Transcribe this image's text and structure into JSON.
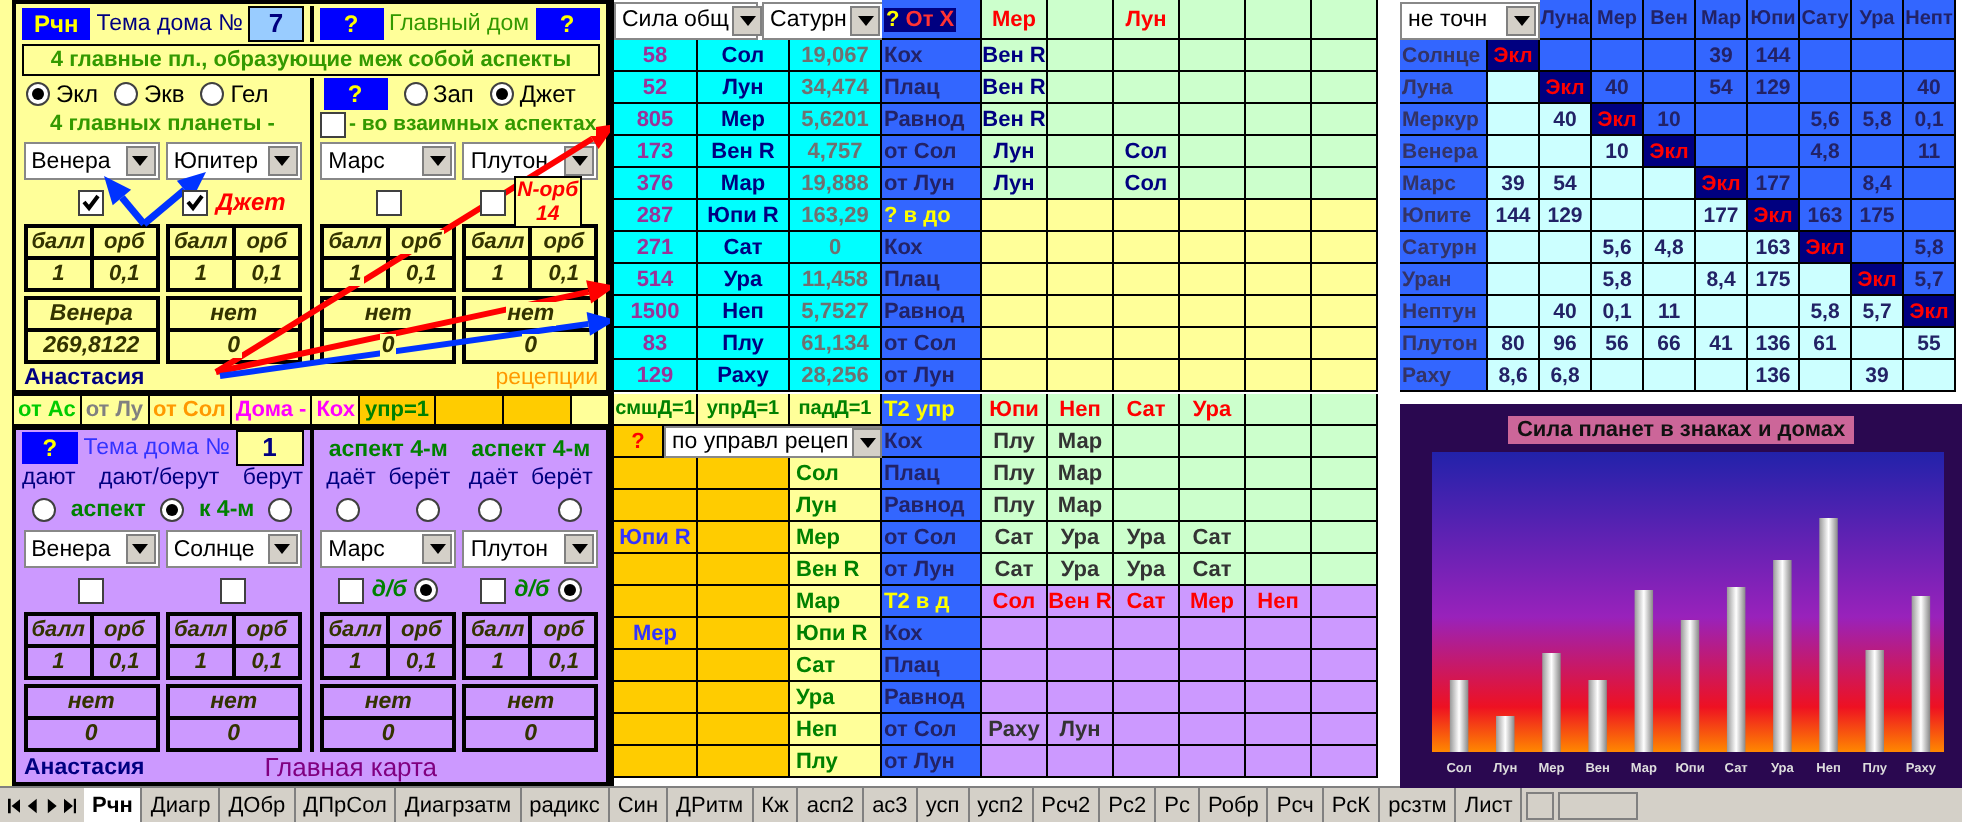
{
  "left_top": {
    "sheet_button": "Рчн",
    "theme_label": "Тема дома №",
    "theme_value": "7",
    "main_house_help": "?",
    "main_house_label": "Главный дом",
    "main_house_value": "?",
    "heading": "4 главные пл., образующие меж собой аспекты",
    "coord_options": [
      {
        "label": "Экл",
        "selected": true
      },
      {
        "label": "Экв",
        "selected": false
      },
      {
        "label": "Гел",
        "selected": false
      }
    ],
    "zodiac_help": "?",
    "zodiac_options": [
      {
        "label": "Зап",
        "selected": false
      },
      {
        "label": "Джет",
        "selected": true
      }
    ],
    "subheading": "4 главных планеты  -",
    "mutual": {
      "label": "- во взаимных аспектах",
      "checked": false
    },
    "blocks": [
      {
        "planet": "Венера",
        "checked": true,
        "score_label": "балл",
        "orb_label": "орб",
        "score": "1",
        "orb": "0,1",
        "result": "Венера",
        "value": "269,8122"
      },
      {
        "planet": "Юпитер",
        "checked": true,
        "note": "Джет",
        "score_label": "балл",
        "orb_label": "орб",
        "score": "1",
        "orb": "0,1",
        "result": "нет",
        "value": "0"
      },
      {
        "planet": "Марс",
        "checked": false,
        "score_label": "балл",
        "orb_label": "орб",
        "score": "1",
        "orb": "0,1",
        "result": "нет",
        "value": "0"
      },
      {
        "planet": "Плутон",
        "checked": false,
        "n_orb_label": "N-орб",
        "n_orb": "14",
        "score_label": "балл",
        "orb_label": "орб",
        "score": "1",
        "orb": "0,1",
        "result": "нет",
        "value": "0"
      }
    ],
    "name": "Анастасия",
    "receptions": "рецепции"
  },
  "strip": [
    {
      "text": "от Ас",
      "kind": "asc"
    },
    {
      "text": "от Лу",
      "kind": "moon"
    },
    {
      "text": "от Сол",
      "kind": "sun"
    },
    {
      "text": "Дома -",
      "kind": "house"
    },
    {
      "text": "Кох",
      "kind": "house"
    },
    {
      "text": "упр=1",
      "kind": "rule"
    }
  ],
  "left_bottom": {
    "help": "?",
    "theme_label": "Тема дома №",
    "theme_value": "1",
    "options": [
      {
        "label": "дают",
        "selected": false
      },
      {
        "label": "дают/берут",
        "selected": true
      },
      {
        "label": "берут",
        "selected": false
      }
    ],
    "caption_left": "аспект",
    "caption_right": "к 4-м",
    "blocks": [
      {
        "planet": "Венера",
        "checked": false,
        "score_label": "балл",
        "orb_label": "орб",
        "score": "1",
        "orb": "0,1",
        "result": "нет",
        "value": "0"
      },
      {
        "planet": "Солнце",
        "checked": false,
        "score_label": "балл",
        "orb_label": "орб",
        "score": "1",
        "orb": "0,1",
        "result": "нет",
        "value": "0"
      },
      {
        "header": "аспект 4-м",
        "options": [
          {
            "label": "даёт",
            "selected": false
          },
          {
            "label": "берёт",
            "selected": false
          }
        ],
        "planet": "Марс",
        "checked": false,
        "db_label": "д/б",
        "db_selected": true,
        "score_label": "балл",
        "orb_label": "орб",
        "score": "1",
        "orb": "0,1",
        "result": "нет",
        "value": "0"
      },
      {
        "header": "аспект 4-м",
        "options": [
          {
            "label": "даёт",
            "selected": false
          },
          {
            "label": "берёт",
            "selected": false
          }
        ],
        "planet": "Плутон",
        "checked": false,
        "db_label": "д/б",
        "db_selected": true,
        "score_label": "балл",
        "orb_label": "орб",
        "score": "1",
        "orb": "0,1",
        "result": "нет",
        "value": "0"
      }
    ],
    "name": "Анастасия",
    "chart_name": "Главная карта"
  },
  "middle_top": {
    "selectors": [
      "Сила общ",
      "Сатурн"
    ],
    "help": "?",
    "title": "От Х",
    "columns": [
      "Мер",
      null,
      "Лун",
      null,
      null,
      null
    ],
    "rows": [
      {
        "kind": "aspect",
        "score": "58",
        "planet": "Сол",
        "degrees": "19,067",
        "method": "Кох",
        "cells": [
          "Вен R",
          null,
          null,
          null,
          null,
          null
        ]
      },
      {
        "kind": "aspect",
        "score": "52",
        "planet": "Лун",
        "degrees": "34,474",
        "method": "Плац",
        "cells": [
          "Вен R",
          null,
          null,
          null,
          null,
          null
        ]
      },
      {
        "kind": "aspect",
        "score": "805",
        "planet": "Мер",
        "degrees": "5,6201",
        "method": "Равнод",
        "cells": [
          "Вен R",
          null,
          null,
          null,
          null,
          null
        ]
      },
      {
        "kind": "aspect",
        "score": "173",
        "planet": "Вен R",
        "degrees": "4,757",
        "method": "от Сол",
        "cells": [
          "Лун",
          null,
          "Сол",
          null,
          null,
          null
        ]
      },
      {
        "kind": "aspect",
        "score": "376",
        "planet": "Мар",
        "degrees": "19,888",
        "method": "от Лун",
        "cells": [
          "Лун",
          null,
          "Сол",
          null,
          null,
          null
        ]
      },
      {
        "kind": "header",
        "score": "287",
        "planet": "Юпи R",
        "degrees": "163,29",
        "method": "? в до"
      },
      {
        "kind": "house",
        "score": "271",
        "planet": "Сат",
        "degrees": "0",
        "method": "Кох"
      },
      {
        "kind": "house",
        "score": "514",
        "planet": "Ура",
        "degrees": "11,458",
        "method": "Плац"
      },
      {
        "kind": "house",
        "score": "1500",
        "planet": "Неп",
        "degrees": "5,7527",
        "method": "Равнод"
      },
      {
        "kind": "house",
        "score": "83",
        "planet": "Плу",
        "degrees": "61,134",
        "method": "от Сол"
      },
      {
        "kind": "house",
        "score": "129",
        "planet": "Раху",
        "degrees": "28,256",
        "method": "от Лун"
      }
    ]
  },
  "middle_bottom": {
    "strip": [
      "смшД=1",
      "упрД=1",
      "падД=1"
    ],
    "title": "T2 упр",
    "columns": [
      "Юпи",
      "Неп",
      "Сат",
      "Ура",
      null,
      null
    ],
    "help": "?",
    "selector": "по управл рецеп",
    "rows": [
      {
        "kind": "upr",
        "method": "Кох",
        "cells": [
          "Плу",
          "Мар",
          null,
          null,
          null,
          null
        ]
      },
      {
        "kind": "upr",
        "planet": "Сол",
        "method": "Плац",
        "cells": [
          "Плу",
          "Мар",
          null,
          null,
          null,
          null
        ]
      },
      {
        "kind": "upr",
        "planet": "Лун",
        "method": "Равнод",
        "cells": [
          "Плу",
          "Мар",
          null,
          null,
          null,
          null
        ]
      },
      {
        "kind": "upr",
        "ruler": "Юпи R",
        "planet": "Мер",
        "method": "от Сол",
        "cells": [
          "Сат",
          "Ура",
          "Ура",
          "Сат",
          null,
          null
        ]
      },
      {
        "kind": "upr",
        "planet": "Вен R",
        "method": "от Лун",
        "cells": [
          "Сат",
          "Ура",
          "Ура",
          "Сат",
          null,
          null
        ]
      },
      {
        "kind": "header",
        "planet": "Мар",
        "method": "T2 в д",
        "cells": [
          "Сол",
          "Вен R",
          "Сат",
          "Мер",
          "Неп",
          null
        ]
      },
      {
        "kind": "house",
        "ruler": "Мер",
        "planet": "Юпи R",
        "method": "Кох"
      },
      {
        "kind": "house",
        "planet": "Сат",
        "method": "Плац"
      },
      {
        "kind": "house",
        "planet": "Ура",
        "method": "Равнод"
      },
      {
        "kind": "house",
        "planet": "Неп",
        "method": "от Сол",
        "cells": [
          "Раху",
          "Лун",
          null,
          null,
          null,
          null
        ]
      },
      {
        "kind": "house",
        "planet": "Плу",
        "method": "от Лун"
      }
    ]
  },
  "matrix": {
    "selector": "не точн",
    "columns": [
      "",
      "Луна",
      "Мер",
      "Вен",
      "Мар",
      "Юпи",
      "Сату",
      "Ура",
      "Непт"
    ],
    "rows": [
      {
        "label": "Солнце",
        "cells": [
          "Экл",
          null,
          null,
          null,
          "39",
          "144",
          null,
          null,
          null
        ]
      },
      {
        "label": "Луна",
        "cells": [
          null,
          "Экл",
          "40",
          null,
          "54",
          "129",
          null,
          null,
          "40"
        ]
      },
      {
        "label": "Меркур",
        "cells": [
          null,
          "40",
          "Экл",
          "10",
          null,
          null,
          "5,6",
          "5,8",
          "0,1"
        ]
      },
      {
        "label": "Венера",
        "cells": [
          null,
          null,
          "10",
          "Экл",
          null,
          null,
          "4,8",
          null,
          "11"
        ]
      },
      {
        "label": "Марс",
        "cells": [
          "39",
          "54",
          null,
          null,
          "Экл",
          "177",
          null,
          "8,4",
          null
        ]
      },
      {
        "label": "Юпите",
        "cells": [
          "144",
          "129",
          null,
          null,
          "177",
          "Экл",
          "163",
          "175",
          null
        ]
      },
      {
        "label": "Сатурн",
        "cells": [
          null,
          null,
          "5,6",
          "4,8",
          null,
          "163",
          "Экл",
          null,
          "5,8"
        ]
      },
      {
        "label": "Уран",
        "cells": [
          null,
          null,
          "5,8",
          null,
          "8,4",
          "175",
          null,
          "Экл",
          "5,7"
        ]
      },
      {
        "label": "Нептун",
        "cells": [
          null,
          "40",
          "0,1",
          "11",
          null,
          null,
          "5,8",
          "5,7",
          "Экл"
        ]
      },
      {
        "label": "Плутон",
        "cells": [
          "80",
          "96",
          "56",
          "66",
          "41",
          "136",
          "61",
          null,
          "55"
        ]
      },
      {
        "label": "Раху",
        "cells": [
          "8,6",
          "6,8",
          null,
          null,
          null,
          "136",
          null,
          "39",
          null
        ]
      }
    ]
  },
  "chart": {
    "title": "Сила планет в знаках и домах",
    "labels": [
      "Сол",
      "Лун",
      "Мер",
      "Вен",
      "Мар",
      "Юпи",
      "Сат",
      "Ура",
      "Неп",
      "Плу",
      "Раху"
    ]
  },
  "tabs": [
    {
      "label": "Рчн",
      "selected": true
    },
    {
      "label": "Диагр",
      "selected": false
    },
    {
      "label": "ДОбр",
      "selected": false
    },
    {
      "label": "ДПрСол",
      "selected": false
    },
    {
      "label": "Диагрзатм",
      "selected": false
    },
    {
      "label": "радикс",
      "selected": false
    },
    {
      "label": "Син",
      "selected": false
    },
    {
      "label": "ДРитм",
      "selected": false
    },
    {
      "label": "Кж",
      "selected": false
    },
    {
      "label": "асп2",
      "selected": false
    },
    {
      "label": "ас3",
      "selected": false
    },
    {
      "label": "усп",
      "selected": false
    },
    {
      "label": "усп2",
      "selected": false
    },
    {
      "label": "Рсч2",
      "selected": false
    },
    {
      "label": "Рс2",
      "selected": false
    },
    {
      "label": "Рс",
      "selected": false
    },
    {
      "label": "Робр",
      "selected": false
    },
    {
      "label": "Рсч",
      "selected": false
    },
    {
      "label": "РсК",
      "selected": false
    },
    {
      "label": "рсзтм",
      "selected": false
    },
    {
      "label": "Лист",
      "selected": false
    }
  ]
}
